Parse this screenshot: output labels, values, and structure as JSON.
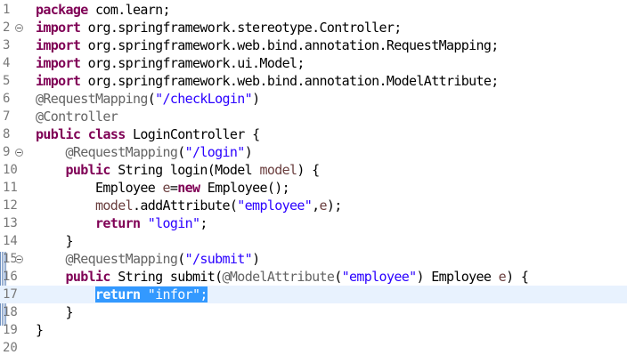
{
  "editor": {
    "lines": [
      {
        "num": "1",
        "fold": false,
        "current": false,
        "tokens": [
          {
            "t": "kw",
            "v": "package"
          },
          {
            "t": "",
            "v": " com.learn;"
          }
        ]
      },
      {
        "num": "2",
        "fold": true,
        "current": false,
        "tokens": [
          {
            "t": "kw",
            "v": "import"
          },
          {
            "t": "",
            "v": " org.springframework.stereotype.Controller;"
          }
        ]
      },
      {
        "num": "3",
        "fold": false,
        "current": false,
        "tokens": [
          {
            "t": "kw",
            "v": "import"
          },
          {
            "t": "",
            "v": " org.springframework.web.bind.annotation.RequestMapping;"
          }
        ]
      },
      {
        "num": "4",
        "fold": false,
        "current": false,
        "tokens": [
          {
            "t": "kw",
            "v": "import"
          },
          {
            "t": "",
            "v": " org.springframework.ui.Model;"
          }
        ]
      },
      {
        "num": "5",
        "fold": false,
        "current": false,
        "tokens": [
          {
            "t": "kw",
            "v": "import"
          },
          {
            "t": "",
            "v": " org.springframework.web.bind.annotation.ModelAttribute;"
          }
        ]
      },
      {
        "num": "6",
        "fold": false,
        "current": false,
        "tokens": [
          {
            "t": "an",
            "v": "@RequestMapping"
          },
          {
            "t": "",
            "v": "("
          },
          {
            "t": "st",
            "v": "\"/checkLogin\""
          },
          {
            "t": "",
            "v": ")"
          }
        ]
      },
      {
        "num": "7",
        "fold": false,
        "current": false,
        "tokens": [
          {
            "t": "an",
            "v": "@Controller"
          }
        ]
      },
      {
        "num": "8",
        "fold": false,
        "current": false,
        "tokens": [
          {
            "t": "kw",
            "v": "public"
          },
          {
            "t": "",
            "v": " "
          },
          {
            "t": "kw",
            "v": "class"
          },
          {
            "t": "",
            "v": " LoginController {"
          }
        ]
      },
      {
        "num": "9",
        "fold": true,
        "current": false,
        "tokens": [
          {
            "t": "",
            "v": "    "
          },
          {
            "t": "an",
            "v": "@RequestMapping"
          },
          {
            "t": "",
            "v": "("
          },
          {
            "t": "st",
            "v": "\"/login\""
          },
          {
            "t": "",
            "v": ")"
          }
        ]
      },
      {
        "num": "10",
        "fold": false,
        "current": false,
        "tokens": [
          {
            "t": "",
            "v": "    "
          },
          {
            "t": "kw",
            "v": "public"
          },
          {
            "t": "",
            "v": " String login(Model "
          },
          {
            "t": "pr",
            "v": "model"
          },
          {
            "t": "",
            "v": ") {"
          }
        ]
      },
      {
        "num": "11",
        "fold": false,
        "current": false,
        "tokens": [
          {
            "t": "",
            "v": "        Employee "
          },
          {
            "t": "pr",
            "v": "e"
          },
          {
            "t": "",
            "v": "="
          },
          {
            "t": "kw",
            "v": "new"
          },
          {
            "t": "",
            "v": " Employee();"
          }
        ]
      },
      {
        "num": "12",
        "fold": false,
        "current": false,
        "tokens": [
          {
            "t": "",
            "v": "        "
          },
          {
            "t": "pr",
            "v": "model"
          },
          {
            "t": "",
            "v": ".addAttribute("
          },
          {
            "t": "st",
            "v": "\"employee\""
          },
          {
            "t": "",
            "v": ","
          },
          {
            "t": "pr",
            "v": "e"
          },
          {
            "t": "",
            "v": ");"
          }
        ]
      },
      {
        "num": "13",
        "fold": false,
        "current": false,
        "tokens": [
          {
            "t": "",
            "v": "        "
          },
          {
            "t": "kw",
            "v": "return"
          },
          {
            "t": "",
            "v": " "
          },
          {
            "t": "st",
            "v": "\"login\""
          },
          {
            "t": "",
            "v": ";"
          }
        ]
      },
      {
        "num": "14",
        "fold": false,
        "current": false,
        "tokens": [
          {
            "t": "",
            "v": "    }"
          }
        ]
      },
      {
        "num": "15",
        "fold": true,
        "current": false,
        "tokens": [
          {
            "t": "",
            "v": "    "
          },
          {
            "t": "an",
            "v": "@RequestMapping"
          },
          {
            "t": "",
            "v": "("
          },
          {
            "t": "st",
            "v": "\"/submit\""
          },
          {
            "t": "",
            "v": ")"
          }
        ]
      },
      {
        "num": "16",
        "fold": false,
        "current": false,
        "tokens": [
          {
            "t": "",
            "v": "    "
          },
          {
            "t": "kw",
            "v": "public"
          },
          {
            "t": "",
            "v": " String submit("
          },
          {
            "t": "an",
            "v": "@ModelAttribute"
          },
          {
            "t": "",
            "v": "("
          },
          {
            "t": "st",
            "v": "\"employee\""
          },
          {
            "t": "",
            "v": ") Employee "
          },
          {
            "t": "pr",
            "v": "e"
          },
          {
            "t": "",
            "v": ") {"
          }
        ]
      },
      {
        "num": "17",
        "fold": false,
        "current": true,
        "tokens": [
          {
            "t": "",
            "v": "        "
          },
          {
            "t": "caret",
            "v": ""
          },
          {
            "t": "kw",
            "v": "return",
            "sel": true
          },
          {
            "t": "",
            "v": " ",
            "sel": true
          },
          {
            "t": "st",
            "v": "\"infor\"",
            "sel": true
          },
          {
            "t": "",
            "v": ";",
            "sel": true
          }
        ]
      },
      {
        "num": "18",
        "fold": false,
        "current": false,
        "tokens": [
          {
            "t": "",
            "v": "    }"
          }
        ]
      },
      {
        "num": "19",
        "fold": false,
        "current": false,
        "tokens": [
          {
            "t": "",
            "v": "}"
          }
        ]
      },
      {
        "num": "20",
        "fold": false,
        "current": false,
        "tokens": []
      }
    ],
    "colors": {
      "keyword": "#7f0055",
      "annotation": "#646464",
      "string": "#2a00ff",
      "parameter": "#6a3e3e",
      "selection": "#3399ff",
      "current_line": "#e8f2fe"
    }
  }
}
